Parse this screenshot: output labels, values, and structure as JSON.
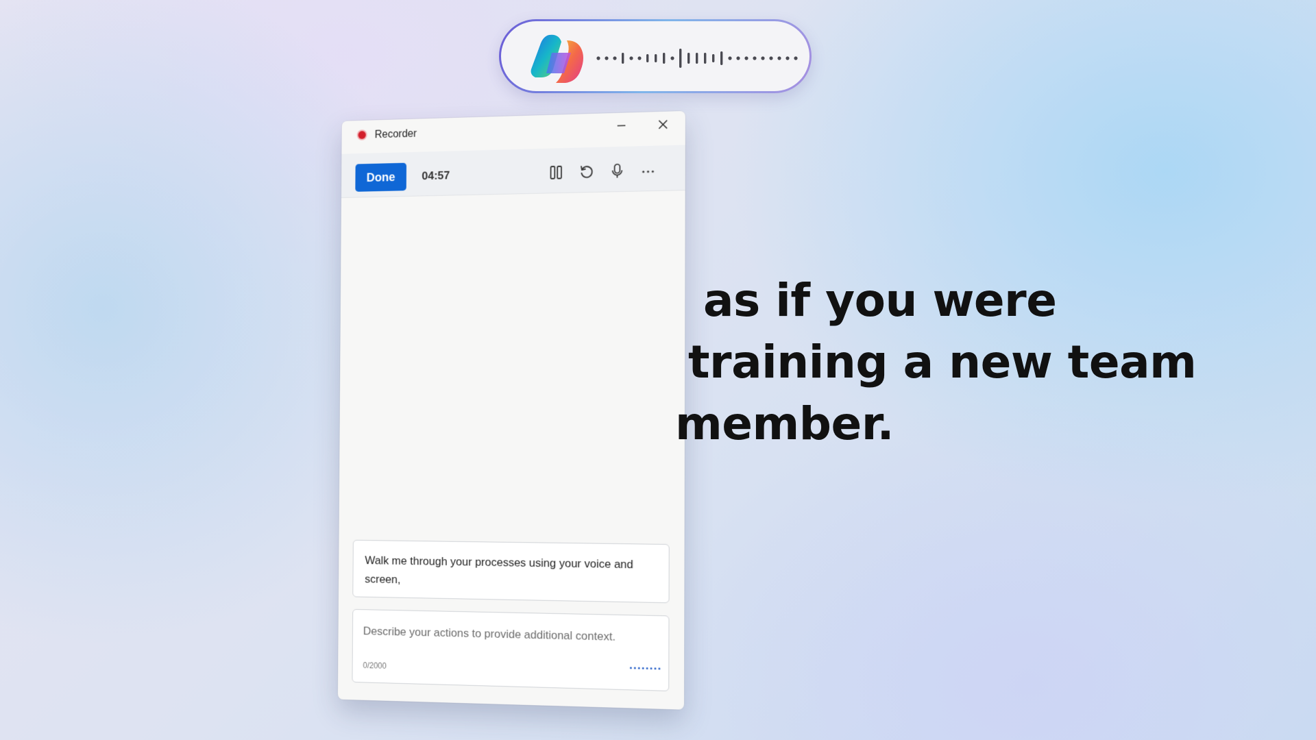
{
  "voice_pill": {
    "logo_icon": "copilot-logo-icon",
    "waveform_icon": "voice-waveform-icon"
  },
  "recorder": {
    "title": "Recorder",
    "done_label": "Done",
    "timer": "04:57",
    "icons": {
      "record": "record-dot-icon",
      "minimize": "minimize-icon",
      "close": "close-icon",
      "pause": "pause-icon",
      "restart": "restart-icon",
      "microphone": "microphone-icon",
      "more": "more-icon"
    },
    "prompt_text": "Walk me through your processes using your voice and screen,",
    "context_placeholder": "Describe your actions to provide additional context.",
    "char_count": "0/2000"
  },
  "caption": {
    "line1": "as if you were",
    "line2": "training a new team",
    "line3": "member."
  },
  "colors": {
    "accent": "#0f67d6",
    "record_red": "#d21f2b"
  }
}
